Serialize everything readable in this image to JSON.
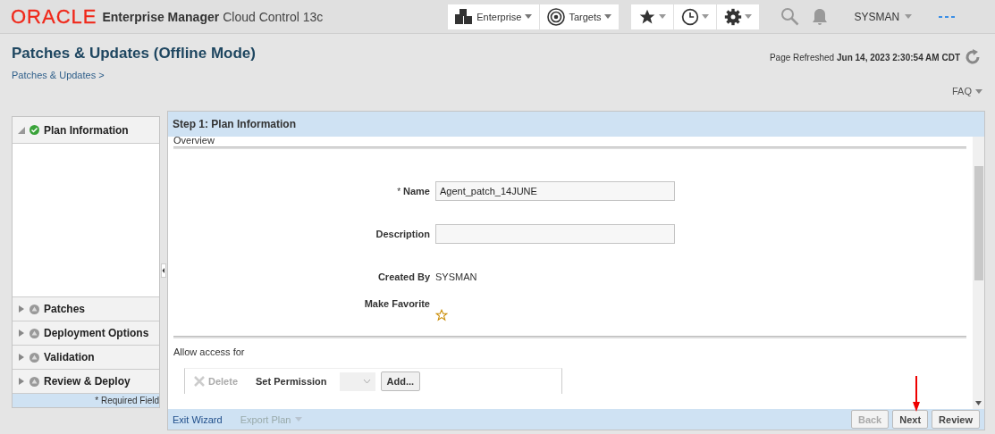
{
  "header": {
    "logo": "ORACLE",
    "product_bold": "Enterprise Manager",
    "product": "Cloud Control 13c",
    "menus": [
      {
        "kind": "enterprise",
        "label": "Enterprise"
      },
      {
        "kind": "targets",
        "label": "Targets"
      }
    ],
    "tools": [
      {
        "kind": "star"
      },
      {
        "kind": "clock"
      },
      {
        "kind": "gear"
      }
    ],
    "user": "SYSMAN"
  },
  "page": {
    "title": "Patches & Updates (Offline Mode)",
    "breadcrumb": "Patches & Updates >",
    "refreshed_label": "Page Refreshed",
    "refreshed_time": "Jun 14, 2023 2:30:54 AM CDT",
    "faq": "FAQ"
  },
  "steps": [
    {
      "label": "Plan Information",
      "expanded": true,
      "complete": true
    },
    {
      "label": "Patches",
      "expanded": false,
      "complete": false
    },
    {
      "label": "Deployment Options",
      "expanded": false,
      "complete": false
    },
    {
      "label": "Validation",
      "expanded": false,
      "complete": false
    },
    {
      "label": "Review & Deploy",
      "expanded": false,
      "complete": false
    }
  ],
  "required_note": "* Required Field",
  "wizard": {
    "step_title": "Step 1: Plan Information",
    "section": "Overview",
    "fields": [
      {
        "kind": "input",
        "label": "Name",
        "required_mark": "*",
        "value": "Agent_patch_14JUNE"
      },
      {
        "kind": "input",
        "label": "Description"
      },
      {
        "kind": "text",
        "label": "Created By",
        "value": "SYSMAN"
      },
      {
        "kind": "star",
        "label": "Make Favorite",
        "checked": false
      }
    ],
    "access": {
      "label": "Allow access for",
      "delete": {
        "label": "Delete",
        "disabled": true
      },
      "permission_label": "Set Permission",
      "add": "Add..."
    }
  },
  "footer": {
    "links": [
      {
        "label": "Exit Wizard",
        "disabled": false,
        "menu": false
      },
      {
        "label": "Export Plan",
        "disabled": true,
        "menu": true
      }
    ],
    "buttons": [
      {
        "label": "Back",
        "disabled": true
      },
      {
        "label": "Next",
        "disabled": false
      },
      {
        "label": "Review",
        "disabled": false
      }
    ]
  }
}
